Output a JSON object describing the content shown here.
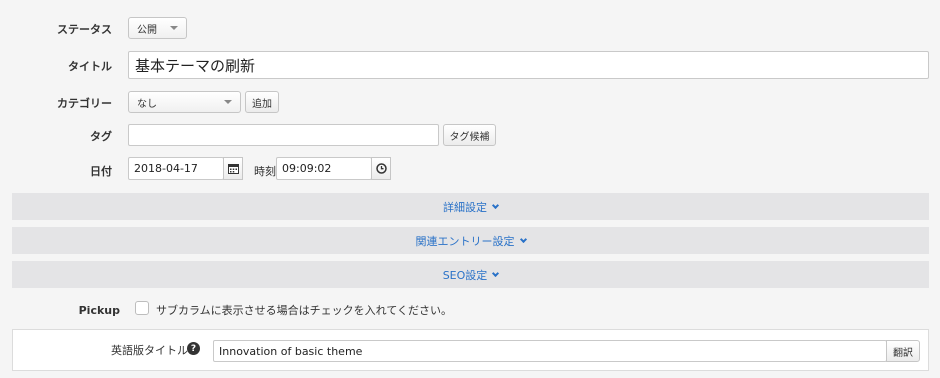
{
  "status": {
    "label": "ステータス",
    "value": "公開"
  },
  "title": {
    "label": "タイトル",
    "value": "基本テーマの刷新"
  },
  "category": {
    "label": "カテゴリー",
    "value": "なし",
    "add_label": "追加"
  },
  "tags": {
    "label": "タグ",
    "value": "",
    "suggest_label": "タグ候補"
  },
  "date": {
    "label": "日付",
    "value": "2018-04-17",
    "time_label": "時刻",
    "time_value": "09:09:02"
  },
  "sections": {
    "details": "詳細設定",
    "related": "関連エントリー設定",
    "seo": "SEO設定"
  },
  "pickup": {
    "label": "Pickup",
    "text": "サブカラムに表示させる場合はチェックを入れてください。",
    "checked": false
  },
  "english_title": {
    "label": "英語版タイトル",
    "value": "Innovation of basic theme",
    "translate_label": "翻訳"
  },
  "colors": {
    "link": "#2a72c8",
    "bar": "#e4e4e6",
    "background": "#f5f5f5"
  },
  "icons": {
    "calendar": "calendar-icon",
    "clock": "clock-icon",
    "help": "question-circle-icon",
    "section": "chevron-down-icon"
  }
}
